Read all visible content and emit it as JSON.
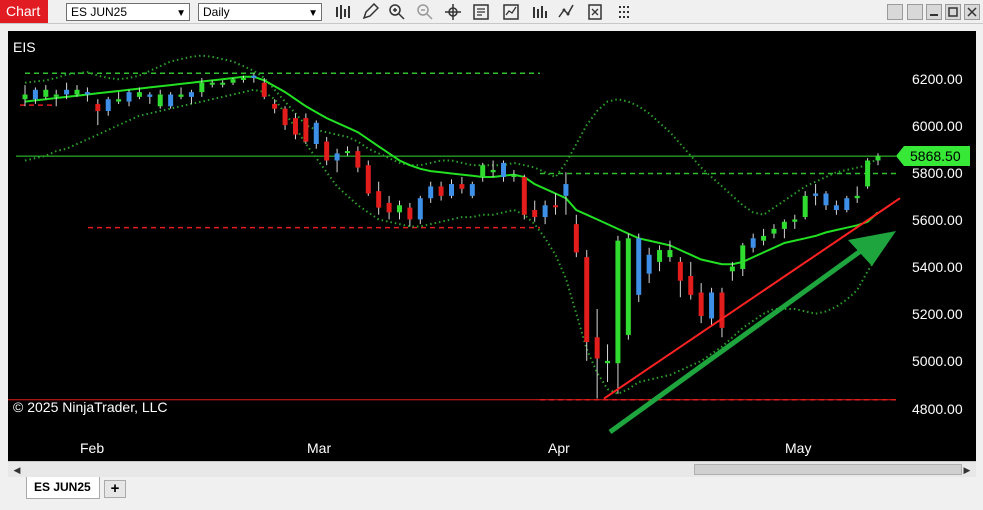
{
  "window": {
    "title": "Chart",
    "instrument_select": "ES JUN25",
    "period_select": "Daily"
  },
  "toolbar": {
    "icons": [
      "bar-style-icon",
      "draw-pencil-icon",
      "zoom-in-icon",
      "zoom-out-icon",
      "crosshair-icon",
      "data-box-icon",
      "indicators-icon",
      "strategies-icon",
      "properties-icon",
      "more-icon"
    ]
  },
  "chart": {
    "instrument_label": "EIS",
    "copyright": "© 2025 NinjaTrader, LLC",
    "last_price": "5868.50",
    "colors": {
      "background": "#000000",
      "up_candle": "#2fdc2f",
      "down_candle": "#e31c1c",
      "blue_candle": "#3d8fe8",
      "moving_average": "#22e022",
      "bollinger": "#2aa02a",
      "trendline": "#ff2222",
      "arrow": "#1ea53e",
      "last_price_label": "#37e837"
    },
    "price_axis": [
      "6200.00",
      "6000.00",
      "5800.00",
      "5600.00",
      "5400.00",
      "5200.00",
      "5000.00",
      "4800.00"
    ],
    "time_axis": [
      "Feb",
      "Mar",
      "Apr",
      "May"
    ]
  },
  "chart_data": {
    "type": "candlestick",
    "instrument": "ES JUN25",
    "period": "Daily",
    "ylim": [
      4750,
      6310
    ],
    "price_ticks": [
      6200,
      6000,
      5800,
      5600,
      5400,
      5200,
      5000,
      4800
    ],
    "last_price": 5868.5,
    "candles": [
      {
        "o": 6130,
        "h": 6170,
        "l": 6080,
        "c": 6110,
        "col": "g"
      },
      {
        "o": 6110,
        "h": 6160,
        "l": 6090,
        "c": 6150,
        "col": "b"
      },
      {
        "o": 6150,
        "h": 6170,
        "l": 6110,
        "c": 6120,
        "col": "g"
      },
      {
        "o": 6120,
        "h": 6150,
        "l": 6080,
        "c": 6130,
        "col": "g"
      },
      {
        "o": 6130,
        "h": 6180,
        "l": 6110,
        "c": 6150,
        "col": "b"
      },
      {
        "o": 6150,
        "h": 6170,
        "l": 6120,
        "c": 6130,
        "col": "g"
      },
      {
        "o": 6130,
        "h": 6160,
        "l": 6100,
        "c": 6140,
        "col": "b"
      },
      {
        "o": 6090,
        "h": 6110,
        "l": 6000,
        "c": 6060,
        "col": "r"
      },
      {
        "o": 6060,
        "h": 6120,
        "l": 6040,
        "c": 6110,
        "col": "b"
      },
      {
        "o": 6110,
        "h": 6140,
        "l": 6090,
        "c": 6100,
        "col": "g"
      },
      {
        "o": 6100,
        "h": 6150,
        "l": 6080,
        "c": 6140,
        "col": "b"
      },
      {
        "o": 6140,
        "h": 6160,
        "l": 6110,
        "c": 6120,
        "col": "g"
      },
      {
        "o": 6120,
        "h": 6140,
        "l": 6090,
        "c": 6130,
        "col": "b"
      },
      {
        "o": 6130,
        "h": 6150,
        "l": 6070,
        "c": 6080,
        "col": "g"
      },
      {
        "o": 6080,
        "h": 6140,
        "l": 6070,
        "c": 6130,
        "col": "b"
      },
      {
        "o": 6130,
        "h": 6160,
        "l": 6110,
        "c": 6120,
        "col": "g"
      },
      {
        "o": 6120,
        "h": 6150,
        "l": 6090,
        "c": 6140,
        "col": "b"
      },
      {
        "o": 6140,
        "h": 6200,
        "l": 6120,
        "c": 6180,
        "col": "g"
      },
      {
        "o": 6180,
        "h": 6190,
        "l": 6160,
        "c": 6175,
        "col": "g"
      },
      {
        "o": 6175,
        "h": 6190,
        "l": 6160,
        "c": 6180,
        "col": "g"
      },
      {
        "o": 6180,
        "h": 6200,
        "l": 6170,
        "c": 6195,
        "col": "g"
      },
      {
        "o": 6195,
        "h": 6210,
        "l": 6180,
        "c": 6200,
        "col": "g"
      },
      {
        "o": 6200,
        "h": 6220,
        "l": 6180,
        "c": 6210,
        "col": "b"
      },
      {
        "o": 6180,
        "h": 6200,
        "l": 6110,
        "c": 6120,
        "col": "r"
      },
      {
        "o": 6090,
        "h": 6110,
        "l": 6050,
        "c": 6070,
        "col": "r"
      },
      {
        "o": 6070,
        "h": 6080,
        "l": 5980,
        "c": 6000,
        "col": "r"
      },
      {
        "o": 6030,
        "h": 6050,
        "l": 5940,
        "c": 5960,
        "col": "r"
      },
      {
        "o": 6030,
        "h": 6050,
        "l": 5920,
        "c": 5930,
        "col": "r"
      },
      {
        "o": 5920,
        "h": 6020,
        "l": 5900,
        "c": 6010,
        "col": "b"
      },
      {
        "o": 5930,
        "h": 5950,
        "l": 5830,
        "c": 5850,
        "col": "r"
      },
      {
        "o": 5850,
        "h": 5900,
        "l": 5800,
        "c": 5880,
        "col": "b"
      },
      {
        "o": 5890,
        "h": 5910,
        "l": 5870,
        "c": 5885,
        "col": "g"
      },
      {
        "o": 5890,
        "h": 5910,
        "l": 5800,
        "c": 5820,
        "col": "r"
      },
      {
        "o": 5830,
        "h": 5850,
        "l": 5700,
        "c": 5710,
        "col": "r"
      },
      {
        "o": 5720,
        "h": 5760,
        "l": 5620,
        "c": 5650,
        "col": "r"
      },
      {
        "o": 5670,
        "h": 5700,
        "l": 5600,
        "c": 5630,
        "col": "r"
      },
      {
        "o": 5630,
        "h": 5680,
        "l": 5600,
        "c": 5660,
        "col": "g"
      },
      {
        "o": 5650,
        "h": 5670,
        "l": 5570,
        "c": 5600,
        "col": "r"
      },
      {
        "o": 5600,
        "h": 5700,
        "l": 5580,
        "c": 5690,
        "col": "b"
      },
      {
        "o": 5690,
        "h": 5760,
        "l": 5670,
        "c": 5740,
        "col": "b"
      },
      {
        "o": 5740,
        "h": 5760,
        "l": 5680,
        "c": 5700,
        "col": "r"
      },
      {
        "o": 5700,
        "h": 5770,
        "l": 5690,
        "c": 5750,
        "col": "b"
      },
      {
        "o": 5750,
        "h": 5780,
        "l": 5710,
        "c": 5730,
        "col": "r"
      },
      {
        "o": 5700,
        "h": 5760,
        "l": 5690,
        "c": 5750,
        "col": "b"
      },
      {
        "o": 5780,
        "h": 5840,
        "l": 5760,
        "c": 5830,
        "col": "g"
      },
      {
        "o": 5800,
        "h": 5850,
        "l": 5780,
        "c": 5810,
        "col": "g"
      },
      {
        "o": 5780,
        "h": 5850,
        "l": 5760,
        "c": 5840,
        "col": "b"
      },
      {
        "o": 5790,
        "h": 5810,
        "l": 5760,
        "c": 5780,
        "col": "g"
      },
      {
        "o": 5780,
        "h": 5790,
        "l": 5600,
        "c": 5620,
        "col": "r"
      },
      {
        "o": 5640,
        "h": 5680,
        "l": 5590,
        "c": 5610,
        "col": "r"
      },
      {
        "o": 5610,
        "h": 5680,
        "l": 5580,
        "c": 5660,
        "col": "b"
      },
      {
        "o": 5660,
        "h": 5710,
        "l": 5620,
        "c": 5660,
        "col": "r"
      },
      {
        "o": 5700,
        "h": 5800,
        "l": 5620,
        "c": 5750,
        "col": "b"
      },
      {
        "o": 5580,
        "h": 5620,
        "l": 5440,
        "c": 5460,
        "col": "r"
      },
      {
        "o": 5440,
        "h": 5470,
        "l": 5000,
        "c": 5080,
        "col": "r"
      },
      {
        "o": 5100,
        "h": 5220,
        "l": 4840,
        "c": 5010,
        "col": "r"
      },
      {
        "o": 5000,
        "h": 5070,
        "l": 4910,
        "c": 4990,
        "col": "g"
      },
      {
        "o": 4990,
        "h": 5530,
        "l": 4860,
        "c": 5510,
        "col": "g"
      },
      {
        "o": 5520,
        "h": 5540,
        "l": 5090,
        "c": 5110,
        "col": "g"
      },
      {
        "o": 5280,
        "h": 5540,
        "l": 5250,
        "c": 5520,
        "col": "b"
      },
      {
        "o": 5450,
        "h": 5480,
        "l": 5330,
        "c": 5370,
        "col": "b"
      },
      {
        "o": 5420,
        "h": 5490,
        "l": 5380,
        "c": 5470,
        "col": "g"
      },
      {
        "o": 5470,
        "h": 5510,
        "l": 5420,
        "c": 5440,
        "col": "g"
      },
      {
        "o": 5420,
        "h": 5440,
        "l": 5270,
        "c": 5340,
        "col": "r"
      },
      {
        "o": 5360,
        "h": 5420,
        "l": 5260,
        "c": 5280,
        "col": "r"
      },
      {
        "o": 5290,
        "h": 5330,
        "l": 5160,
        "c": 5190,
        "col": "r"
      },
      {
        "o": 5180,
        "h": 5310,
        "l": 5150,
        "c": 5290,
        "col": "b"
      },
      {
        "o": 5290,
        "h": 5310,
        "l": 5100,
        "c": 5140,
        "col": "r"
      },
      {
        "o": 5380,
        "h": 5420,
        "l": 5340,
        "c": 5400,
        "col": "g"
      },
      {
        "o": 5390,
        "h": 5500,
        "l": 5360,
        "c": 5490,
        "col": "g"
      },
      {
        "o": 5480,
        "h": 5540,
        "l": 5460,
        "c": 5520,
        "col": "b"
      },
      {
        "o": 5510,
        "h": 5560,
        "l": 5490,
        "c": 5530,
        "col": "g"
      },
      {
        "o": 5540,
        "h": 5580,
        "l": 5520,
        "c": 5560,
        "col": "g"
      },
      {
        "o": 5560,
        "h": 5600,
        "l": 5520,
        "c": 5590,
        "col": "g"
      },
      {
        "o": 5590,
        "h": 5620,
        "l": 5560,
        "c": 5600,
        "col": "g"
      },
      {
        "o": 5610,
        "h": 5720,
        "l": 5600,
        "c": 5700,
        "col": "g"
      },
      {
        "o": 5700,
        "h": 5750,
        "l": 5660,
        "c": 5710,
        "col": "b"
      },
      {
        "o": 5710,
        "h": 5720,
        "l": 5640,
        "c": 5660,
        "col": "b"
      },
      {
        "o": 5660,
        "h": 5680,
        "l": 5620,
        "c": 5640,
        "col": "b"
      },
      {
        "o": 5640,
        "h": 5700,
        "l": 5630,
        "c": 5690,
        "col": "b"
      },
      {
        "o": 5690,
        "h": 5740,
        "l": 5670,
        "c": 5700,
        "col": "g"
      },
      {
        "o": 5740,
        "h": 5860,
        "l": 5730,
        "c": 5850,
        "col": "g"
      },
      {
        "o": 5850,
        "h": 5880,
        "l": 5830,
        "c": 5868.5,
        "col": "g"
      }
    ],
    "moving_average": [
      6100,
      6105,
      6110,
      6115,
      6120,
      6125,
      6130,
      6135,
      6140,
      6145,
      6150,
      6155,
      6160,
      6165,
      6170,
      6175,
      6180,
      6185,
      6190,
      6195,
      6200,
      6205,
      6205,
      6190,
      6165,
      6140,
      6110,
      6080,
      6055,
      6030,
      6010,
      5990,
      5970,
      5940,
      5910,
      5880,
      5850,
      5830,
      5815,
      5805,
      5800,
      5795,
      5790,
      5785,
      5780,
      5780,
      5785,
      5790,
      5780,
      5750,
      5730,
      5710,
      5690,
      5640,
      5620,
      5600,
      5580,
      5560,
      5540,
      5520,
      5510,
      5500,
      5490,
      5470,
      5450,
      5430,
      5420,
      5410,
      5410,
      5420,
      5440,
      5460,
      5480,
      5500,
      5510,
      5520,
      5530,
      5545,
      5555,
      5565,
      5575,
      5590,
      5630
    ],
    "bollinger_upper": [
      6180,
      6185,
      6190,
      6200,
      6215,
      6220,
      6225,
      6210,
      6200,
      6195,
      6200,
      6210,
      6230,
      6250,
      6270,
      6280,
      6290,
      6295,
      6290,
      6280,
      6270,
      6250,
      6230,
      6200,
      6150,
      6100,
      6050,
      6000,
      5980,
      5970,
      5960,
      5950,
      5930,
      5900,
      5880,
      5860,
      5840,
      5830,
      5830,
      5840,
      5850,
      5850,
      5840,
      5830,
      5830,
      5830,
      5830,
      5840,
      5830,
      5820,
      5800,
      5780,
      5840,
      5920,
      6000,
      6060,
      6100,
      6110,
      6100,
      6080,
      6050,
      6010,
      5970,
      5920,
      5870,
      5820,
      5780,
      5740,
      5700,
      5660,
      5630,
      5620,
      5650,
      5680,
      5710,
      5740,
      5760,
      5780,
      5800,
      5810,
      5820,
      5830,
      5860
    ],
    "bollinger_lower": [
      5850,
      5860,
      5870,
      5890,
      5900,
      5920,
      5940,
      5960,
      5980,
      6000,
      6020,
      6040,
      6050,
      6060,
      6070,
      6080,
      6090,
      6100,
      6110,
      6120,
      6130,
      6140,
      6150,
      6140,
      6110,
      6050,
      5990,
      5920,
      5860,
      5800,
      5740,
      5700,
      5660,
      5630,
      5600,
      5590,
      5580,
      5570,
      5570,
      5580,
      5590,
      5600,
      5610,
      5610,
      5620,
      5620,
      5630,
      5640,
      5620,
      5580,
      5520,
      5450,
      5350,
      5200,
      5050,
      4950,
      4880,
      4860,
      4880,
      4910,
      4920,
      4930,
      4940,
      4960,
      4980,
      5000,
      5030,
      5060,
      5100,
      5140,
      5170,
      5200,
      5220,
      5220,
      5220,
      5210,
      5200,
      5210,
      5230,
      5260,
      5300,
      5380,
      5450
    ]
  }
}
